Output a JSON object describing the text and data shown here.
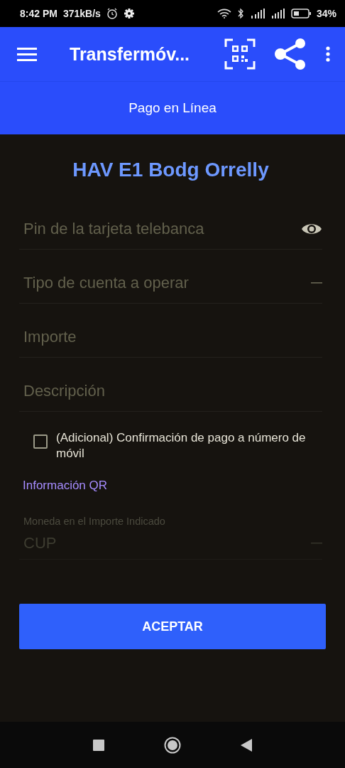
{
  "status_bar": {
    "time": "8:42 PM",
    "speed": "371kB/s",
    "battery": "34%"
  },
  "app_bar": {
    "title": "Transfermóv..."
  },
  "subheader": {
    "title": "Pago en Línea"
  },
  "form": {
    "heading": "HAV E1 Bodg Orrelly",
    "fields": [
      {
        "kind": "password",
        "placeholder": "Pin de la tarjeta telebanca"
      },
      {
        "kind": "dropdown",
        "placeholder": "Tipo de cuenta a operar"
      },
      {
        "kind": "text",
        "placeholder": "Importe"
      },
      {
        "kind": "text",
        "placeholder": "Descripción"
      }
    ],
    "checkbox": {
      "label": "(Adicional) Confirmación de pago a número de móvil",
      "checked": false
    },
    "link": "Información QR",
    "currency": {
      "label": "Moneda en el Importe Indicado",
      "value": "CUP",
      "disabled": true
    },
    "submit": "ACEPTAR"
  }
}
